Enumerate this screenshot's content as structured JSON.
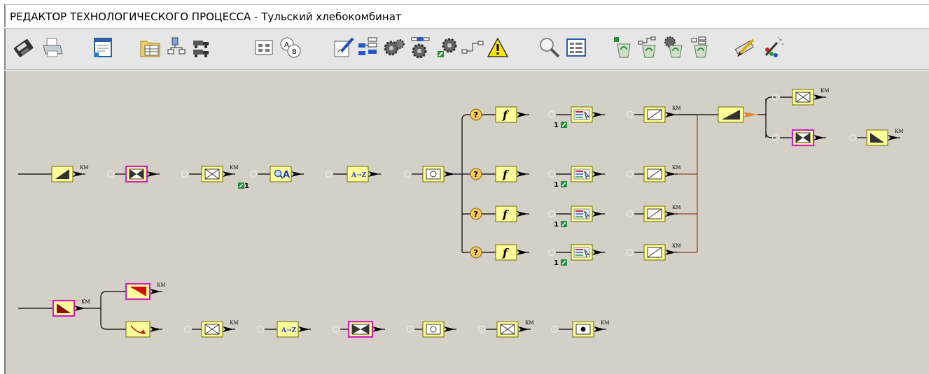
{
  "window": {
    "title": "РЕДАКТОР ТЕХНОЛОГИЧЕСКОГО ПРОЦЕССА - Тульский хлебокомбинат"
  },
  "toolbar": {
    "buttons": [
      {
        "icon": "save-disk-icon"
      },
      {
        "icon": "printer-icon"
      },
      {
        "icon": "document-properties-icon"
      },
      {
        "icon": "folder-table-icon"
      },
      {
        "icon": "tree-structure-icon"
      },
      {
        "icon": "trucks-icon"
      },
      {
        "icon": "module-block-icon"
      },
      {
        "icon": "ab-compare-icon"
      },
      {
        "icon": "edit-document-icon"
      },
      {
        "icon": "hierarchy-icon"
      },
      {
        "icon": "gears-icon"
      },
      {
        "icon": "linked-gears-icon"
      },
      {
        "icon": "gears-plus-icon"
      },
      {
        "icon": "connector-icon"
      },
      {
        "icon": "warning-icon"
      },
      {
        "icon": "magnifier-icon"
      },
      {
        "icon": "list-panel-icon"
      },
      {
        "icon": "recycle-bin-1-icon"
      },
      {
        "icon": "recycle-bin-2-icon"
      },
      {
        "icon": "recycle-bin-3-icon"
      },
      {
        "icon": "recycle-bin-4-icon"
      },
      {
        "icon": "pencil-icon"
      },
      {
        "icon": "magic-wand-icon"
      }
    ]
  },
  "diagram": {
    "km_label": "КМ",
    "counter_one": "1",
    "f_label": "f",
    "question_label": "?",
    "letter_a": "A",
    "az_label": "A→Z",
    "colors": {
      "canvas": "#d4d0c8",
      "node_fill": "#ffff99",
      "node_border": "#6b6b00",
      "selected_border": "#d020c0",
      "connector": "#8b4513",
      "counter_badge": "#1f8f3a"
    }
  }
}
